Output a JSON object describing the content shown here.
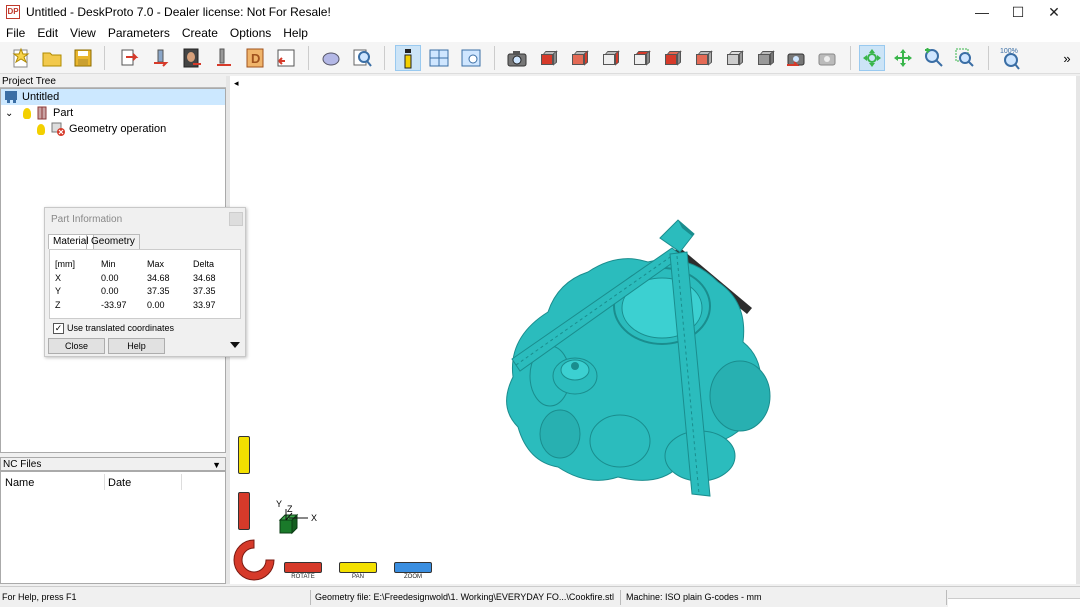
{
  "window": {
    "title": "Untitled - DeskProto 7.0 - Dealer license: Not For Resale!",
    "app_icon_text": "DP",
    "minimize_glyph": "—",
    "maximize_glyph": "☐",
    "close_glyph": "✕"
  },
  "menu": [
    "File",
    "Edit",
    "View",
    "Parameters",
    "Create",
    "Options",
    "Help"
  ],
  "toolbar": {
    "zoom_text": "100%",
    "overflow_glyph": "»",
    "collapse_glyph": "◂"
  },
  "project_tree": {
    "header": "Project Tree",
    "root": "Untitled",
    "part": "Part",
    "operation": "Geometry operation",
    "expand_glyph": "⌄"
  },
  "part_info": {
    "title": "Part Information",
    "tabs": [
      "Material",
      "Geometry"
    ],
    "headers": [
      "[mm]",
      "Min",
      "Max",
      "Delta"
    ],
    "rows": [
      [
        "X",
        "0.00",
        "34.68",
        "34.68"
      ],
      [
        "Y",
        "0.00",
        "37.35",
        "37.35"
      ],
      [
        "Z",
        "-33.97",
        "0.00",
        "33.97"
      ]
    ],
    "checkbox_label": "Use translated coordinates",
    "checkbox_checked": true,
    "checkmark": "✓",
    "close_label": "Close",
    "help_label": "Help"
  },
  "nc_files": {
    "header": "NC Files",
    "columns": [
      "Name",
      "Date"
    ],
    "dropdown_glyph": "▼"
  },
  "viewport": {
    "model_color": "#2bbcbd",
    "rotate_label": "ROTATE",
    "pan_label": "PAN",
    "zoom_label": "ZOOM",
    "axis_y": "Y",
    "axis_z": "Z",
    "axis_x": "X"
  },
  "status": {
    "help": "For Help, press F1",
    "geometry_file": "Geometry file: E:\\Freedesignwold\\1. Working\\EVERYDAY FO...\\Cookfire.stl",
    "machine": "Machine: ISO plain G-codes - mm"
  },
  "colors": {
    "accent_selection": "#cce8ff",
    "rotate_red": "#d63a2a",
    "pan_yellow": "#f3e000",
    "zoom_blue": "#3a8ee0"
  }
}
